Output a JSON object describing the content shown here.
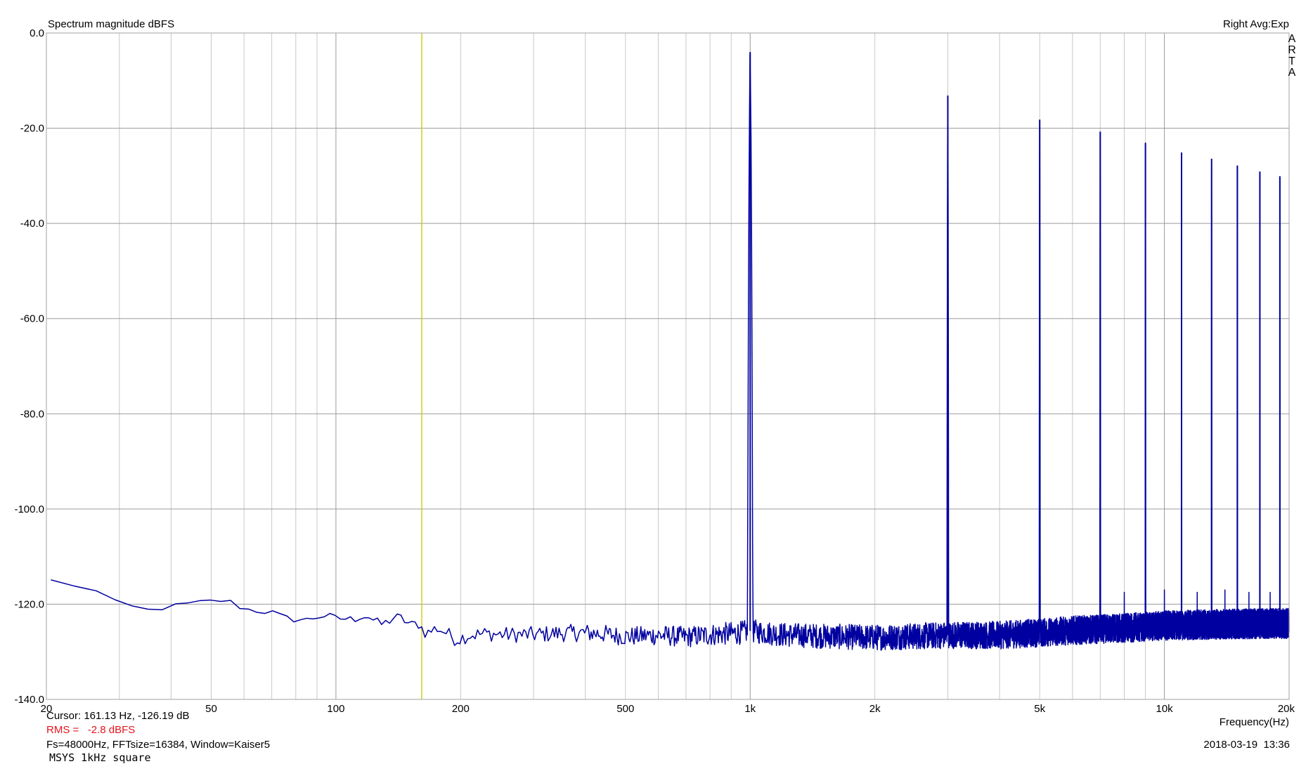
{
  "chart_data": {
    "type": "line",
    "title": "Spectrum magnitude dBFS",
    "title_right": "Right Avg:Exp",
    "watermark": "ARTA",
    "xlabel": "Frequency(Hz)",
    "ylabel": "",
    "xscale": "log",
    "xlim": [
      20,
      20000
    ],
    "ylim": [
      -140,
      0
    ],
    "x_ticks": [
      {
        "value": 20,
        "label": "20"
      },
      {
        "value": 50,
        "label": "50"
      },
      {
        "value": 100,
        "label": "100"
      },
      {
        "value": 200,
        "label": "200"
      },
      {
        "value": 500,
        "label": "500"
      },
      {
        "value": 1000,
        "label": "1k"
      },
      {
        "value": 2000,
        "label": "2k"
      },
      {
        "value": 5000,
        "label": "5k"
      },
      {
        "value": 10000,
        "label": "10k"
      },
      {
        "value": 20000,
        "label": "20k"
      }
    ],
    "y_ticks": [
      {
        "value": 0,
        "label": "0.0"
      },
      {
        "value": -20,
        "label": "-20.0"
      },
      {
        "value": -40,
        "label": "-40.0"
      },
      {
        "value": -60,
        "label": "-60.0"
      },
      {
        "value": -80,
        "label": "-80.0"
      },
      {
        "value": -100,
        "label": "-100.0"
      },
      {
        "value": -120,
        "label": "-120.0"
      },
      {
        "value": -140,
        "label": "-140.0"
      }
    ],
    "grid": true,
    "line_color": "#0000a0",
    "cursor_color": "#c8c800",
    "grid_color": "#b4b4b4",
    "cursor_frequency": 161.13,
    "series": [
      {
        "noise_floor": [
          [
            20,
            -114.8
          ],
          [
            22,
            -115.5
          ],
          [
            24,
            -116.3
          ],
          [
            26,
            -117.0
          ],
          [
            28,
            -118.5
          ],
          [
            30,
            -120.0
          ],
          [
            33,
            -120.7
          ],
          [
            36,
            -121.4
          ],
          [
            39,
            -120.6
          ],
          [
            42,
            -120.2
          ],
          [
            46,
            -119.7
          ],
          [
            50,
            -119.4
          ],
          [
            53,
            -119.2
          ],
          [
            56,
            -119.6
          ],
          [
            60,
            -121.0
          ],
          [
            65,
            -121.4
          ],
          [
            70,
            -121.7
          ],
          [
            75,
            -122.9
          ],
          [
            80,
            -123.2
          ],
          [
            85,
            -123.3
          ],
          [
            90,
            -122.6
          ],
          [
            95,
            -122.4
          ],
          [
            100,
            -123.0
          ],
          [
            105,
            -123.0
          ],
          [
            110,
            -123.3
          ],
          [
            115,
            -122.4
          ],
          [
            120,
            -122.6
          ],
          [
            125,
            -123.8
          ],
          [
            130,
            -124.3
          ],
          [
            138,
            -122.8
          ],
          [
            145,
            -123.1
          ],
          [
            152,
            -124.5
          ],
          [
            158,
            -124.0
          ],
          [
            165,
            -126.2
          ],
          [
            175,
            -125.0
          ],
          [
            185,
            -126.0
          ],
          [
            195,
            -127.5
          ],
          [
            210,
            -126.5
          ],
          [
            230,
            -126.2
          ],
          [
            260,
            -126.4
          ],
          [
            300,
            -126.4
          ],
          [
            350,
            -126.1
          ],
          [
            400,
            -126.0
          ],
          [
            450,
            -126.3
          ],
          [
            500,
            -126.8
          ],
          [
            600,
            -126.5
          ],
          [
            700,
            -126.9
          ],
          [
            800,
            -126.4
          ],
          [
            950,
            -126.0
          ],
          [
            1000,
            -125.6
          ],
          [
            1200,
            -126.4
          ],
          [
            1600,
            -126.8
          ],
          [
            2000,
            -127.0
          ],
          [
            3000,
            -126.5
          ],
          [
            4000,
            -126.5
          ],
          [
            5000,
            -126.0
          ],
          [
            6000,
            -125.5
          ],
          [
            8000,
            -125.0
          ],
          [
            10000,
            -124.5
          ],
          [
            14000,
            -124.2
          ],
          [
            20000,
            -124.0
          ]
        ],
        "noise_amplitude": [
          [
            20,
            0.3
          ],
          [
            100,
            0.8
          ],
          [
            200,
            1.5
          ],
          [
            500,
            2.0
          ],
          [
            1000,
            2.5
          ],
          [
            5000,
            3.0
          ],
          [
            20000,
            3.2
          ]
        ],
        "harmonics": [
          {
            "f": 1000,
            "db": -4.0
          },
          {
            "f": 3000,
            "db": -13.2
          },
          {
            "f": 5000,
            "db": -18.2
          },
          {
            "f": 7000,
            "db": -20.7
          },
          {
            "f": 9000,
            "db": -23.1
          },
          {
            "f": 11000,
            "db": -25.1
          },
          {
            "f": 13000,
            "db": -26.4
          },
          {
            "f": 15000,
            "db": -27.9
          },
          {
            "f": 17000,
            "db": -29.1
          },
          {
            "f": 19000,
            "db": -30.1
          }
        ],
        "minor_spurs": [
          {
            "f": 8000,
            "db": -117.5
          },
          {
            "f": 9000,
            "db": -111.0
          },
          {
            "f": 10000,
            "db": -117.0
          },
          {
            "f": 12000,
            "db": -117.5
          },
          {
            "f": 14000,
            "db": -117.0
          },
          {
            "f": 16000,
            "db": -117.5
          },
          {
            "f": 18000,
            "db": -117.5
          },
          {
            "f": 20000,
            "db": -118.0
          }
        ]
      }
    ]
  },
  "info": {
    "cursor": "Cursor: 161.13 Hz, -126.19 dB",
    "rms": "RMS =   -2.8 dBFS",
    "params": "Fs=48000Hz, FFTsize=16384, Window=Kaiser5",
    "note": "MSYS 1kHz square",
    "datetime": "2018-03-19  13:36"
  }
}
